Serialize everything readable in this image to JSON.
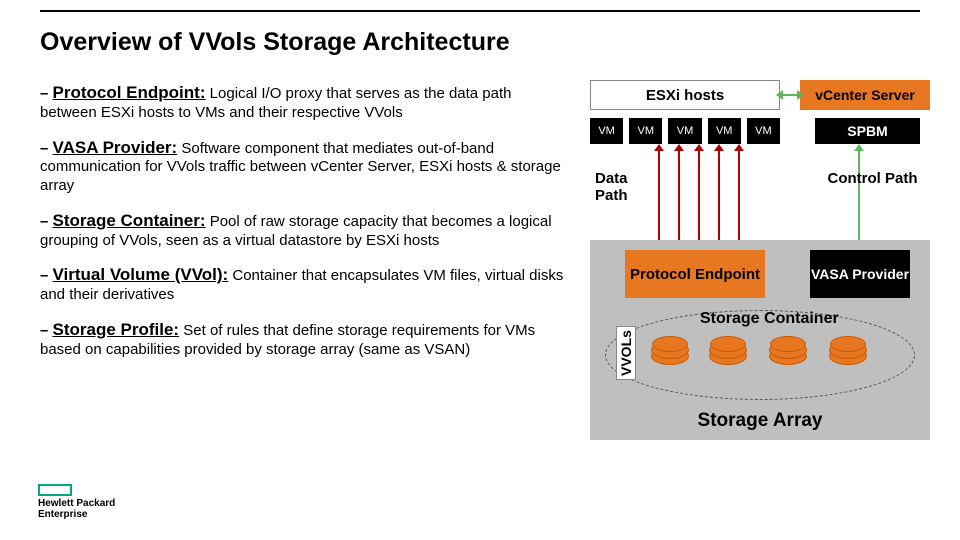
{
  "title": "Overview of VVols Storage Architecture",
  "defs": [
    {
      "term": "Protocol Endpoint:",
      "underline": true,
      "desc": " Logical I/O proxy that serves as the data path between ESXi hosts to VMs and their respective VVols"
    },
    {
      "term": "VASA Provider:",
      "underline": true,
      "desc": " Software component that mediates out-of-band communication for VVols traffic between vCenter Server, ESXi hosts & storage array"
    },
    {
      "term": "Storage Container:",
      "underline": true,
      "desc": " Pool of raw storage capacity that becomes a logical grouping of VVols, seen as a virtual datastore by ESXi hosts"
    },
    {
      "term": "Virtual Volume (VVol):",
      "underline": true,
      "desc": " Container that encapsulates VM files, virtual disks and their derivatives"
    },
    {
      "term": "Storage Profile:",
      "underline": true,
      "desc": " Set of rules that define storage requirements for VMs based on capabilities provided by storage array (same as VSAN)"
    }
  ],
  "diagram": {
    "esxi_hosts": "ESXi hosts",
    "vcenter": "vCenter Server",
    "spbm": "SPBM",
    "vm": "VM",
    "vm_count": 5,
    "data_path": "Data Path",
    "control_path": "Control Path",
    "protocol_endpoint": "Protocol Endpoint",
    "vasa_provider": "VASA Provider",
    "storage_container": "Storage Container",
    "vvols": "VVOLs",
    "storage_array": "Storage Array"
  },
  "arrows": {
    "data_color": "#b00000",
    "control_color": "#5fb65f"
  },
  "logo": {
    "line1": "Hewlett Packard",
    "line2": "Enterprise"
  }
}
